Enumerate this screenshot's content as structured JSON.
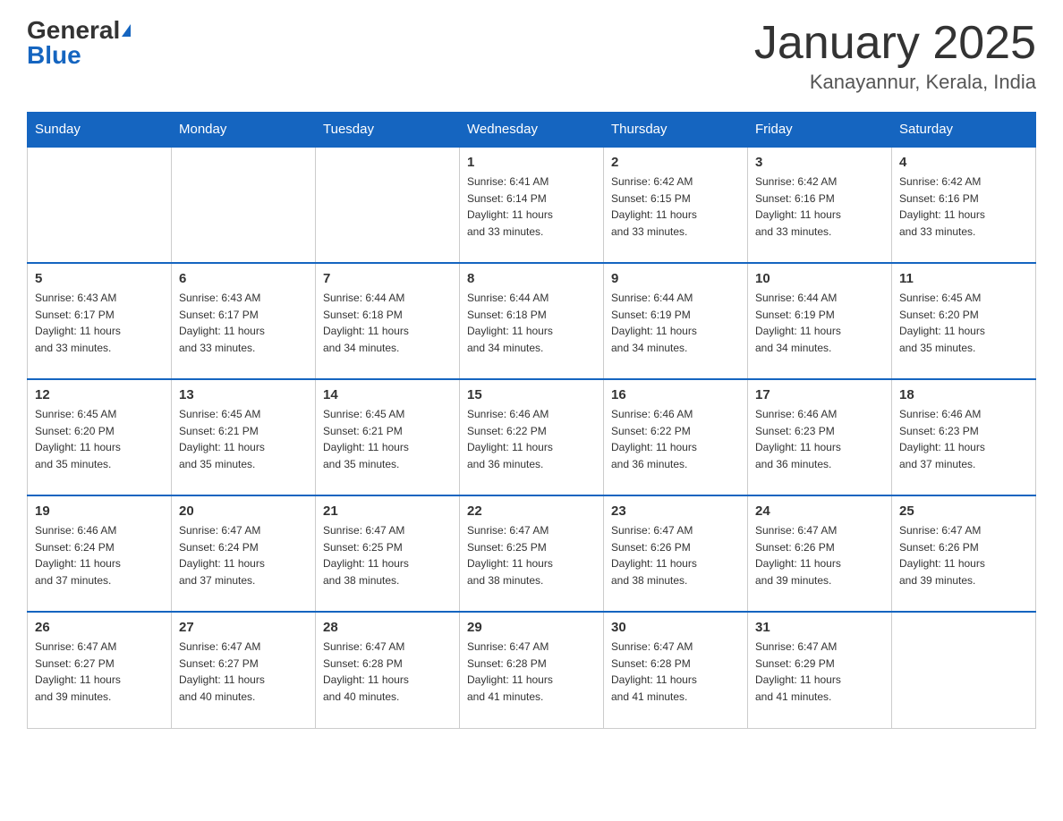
{
  "header": {
    "logo_general": "General",
    "logo_blue": "Blue",
    "title": "January 2025",
    "location": "Kanayannur, Kerala, India"
  },
  "days_of_week": [
    "Sunday",
    "Monday",
    "Tuesday",
    "Wednesday",
    "Thursday",
    "Friday",
    "Saturday"
  ],
  "weeks": [
    [
      {
        "day": "",
        "info": ""
      },
      {
        "day": "",
        "info": ""
      },
      {
        "day": "",
        "info": ""
      },
      {
        "day": "1",
        "info": "Sunrise: 6:41 AM\nSunset: 6:14 PM\nDaylight: 11 hours\nand 33 minutes."
      },
      {
        "day": "2",
        "info": "Sunrise: 6:42 AM\nSunset: 6:15 PM\nDaylight: 11 hours\nand 33 minutes."
      },
      {
        "day": "3",
        "info": "Sunrise: 6:42 AM\nSunset: 6:16 PM\nDaylight: 11 hours\nand 33 minutes."
      },
      {
        "day": "4",
        "info": "Sunrise: 6:42 AM\nSunset: 6:16 PM\nDaylight: 11 hours\nand 33 minutes."
      }
    ],
    [
      {
        "day": "5",
        "info": "Sunrise: 6:43 AM\nSunset: 6:17 PM\nDaylight: 11 hours\nand 33 minutes."
      },
      {
        "day": "6",
        "info": "Sunrise: 6:43 AM\nSunset: 6:17 PM\nDaylight: 11 hours\nand 33 minutes."
      },
      {
        "day": "7",
        "info": "Sunrise: 6:44 AM\nSunset: 6:18 PM\nDaylight: 11 hours\nand 34 minutes."
      },
      {
        "day": "8",
        "info": "Sunrise: 6:44 AM\nSunset: 6:18 PM\nDaylight: 11 hours\nand 34 minutes."
      },
      {
        "day": "9",
        "info": "Sunrise: 6:44 AM\nSunset: 6:19 PM\nDaylight: 11 hours\nand 34 minutes."
      },
      {
        "day": "10",
        "info": "Sunrise: 6:44 AM\nSunset: 6:19 PM\nDaylight: 11 hours\nand 34 minutes."
      },
      {
        "day": "11",
        "info": "Sunrise: 6:45 AM\nSunset: 6:20 PM\nDaylight: 11 hours\nand 35 minutes."
      }
    ],
    [
      {
        "day": "12",
        "info": "Sunrise: 6:45 AM\nSunset: 6:20 PM\nDaylight: 11 hours\nand 35 minutes."
      },
      {
        "day": "13",
        "info": "Sunrise: 6:45 AM\nSunset: 6:21 PM\nDaylight: 11 hours\nand 35 minutes."
      },
      {
        "day": "14",
        "info": "Sunrise: 6:45 AM\nSunset: 6:21 PM\nDaylight: 11 hours\nand 35 minutes."
      },
      {
        "day": "15",
        "info": "Sunrise: 6:46 AM\nSunset: 6:22 PM\nDaylight: 11 hours\nand 36 minutes."
      },
      {
        "day": "16",
        "info": "Sunrise: 6:46 AM\nSunset: 6:22 PM\nDaylight: 11 hours\nand 36 minutes."
      },
      {
        "day": "17",
        "info": "Sunrise: 6:46 AM\nSunset: 6:23 PM\nDaylight: 11 hours\nand 36 minutes."
      },
      {
        "day": "18",
        "info": "Sunrise: 6:46 AM\nSunset: 6:23 PM\nDaylight: 11 hours\nand 37 minutes."
      }
    ],
    [
      {
        "day": "19",
        "info": "Sunrise: 6:46 AM\nSunset: 6:24 PM\nDaylight: 11 hours\nand 37 minutes."
      },
      {
        "day": "20",
        "info": "Sunrise: 6:47 AM\nSunset: 6:24 PM\nDaylight: 11 hours\nand 37 minutes."
      },
      {
        "day": "21",
        "info": "Sunrise: 6:47 AM\nSunset: 6:25 PM\nDaylight: 11 hours\nand 38 minutes."
      },
      {
        "day": "22",
        "info": "Sunrise: 6:47 AM\nSunset: 6:25 PM\nDaylight: 11 hours\nand 38 minutes."
      },
      {
        "day": "23",
        "info": "Sunrise: 6:47 AM\nSunset: 6:26 PM\nDaylight: 11 hours\nand 38 minutes."
      },
      {
        "day": "24",
        "info": "Sunrise: 6:47 AM\nSunset: 6:26 PM\nDaylight: 11 hours\nand 39 minutes."
      },
      {
        "day": "25",
        "info": "Sunrise: 6:47 AM\nSunset: 6:26 PM\nDaylight: 11 hours\nand 39 minutes."
      }
    ],
    [
      {
        "day": "26",
        "info": "Sunrise: 6:47 AM\nSunset: 6:27 PM\nDaylight: 11 hours\nand 39 minutes."
      },
      {
        "day": "27",
        "info": "Sunrise: 6:47 AM\nSunset: 6:27 PM\nDaylight: 11 hours\nand 40 minutes."
      },
      {
        "day": "28",
        "info": "Sunrise: 6:47 AM\nSunset: 6:28 PM\nDaylight: 11 hours\nand 40 minutes."
      },
      {
        "day": "29",
        "info": "Sunrise: 6:47 AM\nSunset: 6:28 PM\nDaylight: 11 hours\nand 41 minutes."
      },
      {
        "day": "30",
        "info": "Sunrise: 6:47 AM\nSunset: 6:28 PM\nDaylight: 11 hours\nand 41 minutes."
      },
      {
        "day": "31",
        "info": "Sunrise: 6:47 AM\nSunset: 6:29 PM\nDaylight: 11 hours\nand 41 minutes."
      },
      {
        "day": "",
        "info": ""
      }
    ]
  ]
}
